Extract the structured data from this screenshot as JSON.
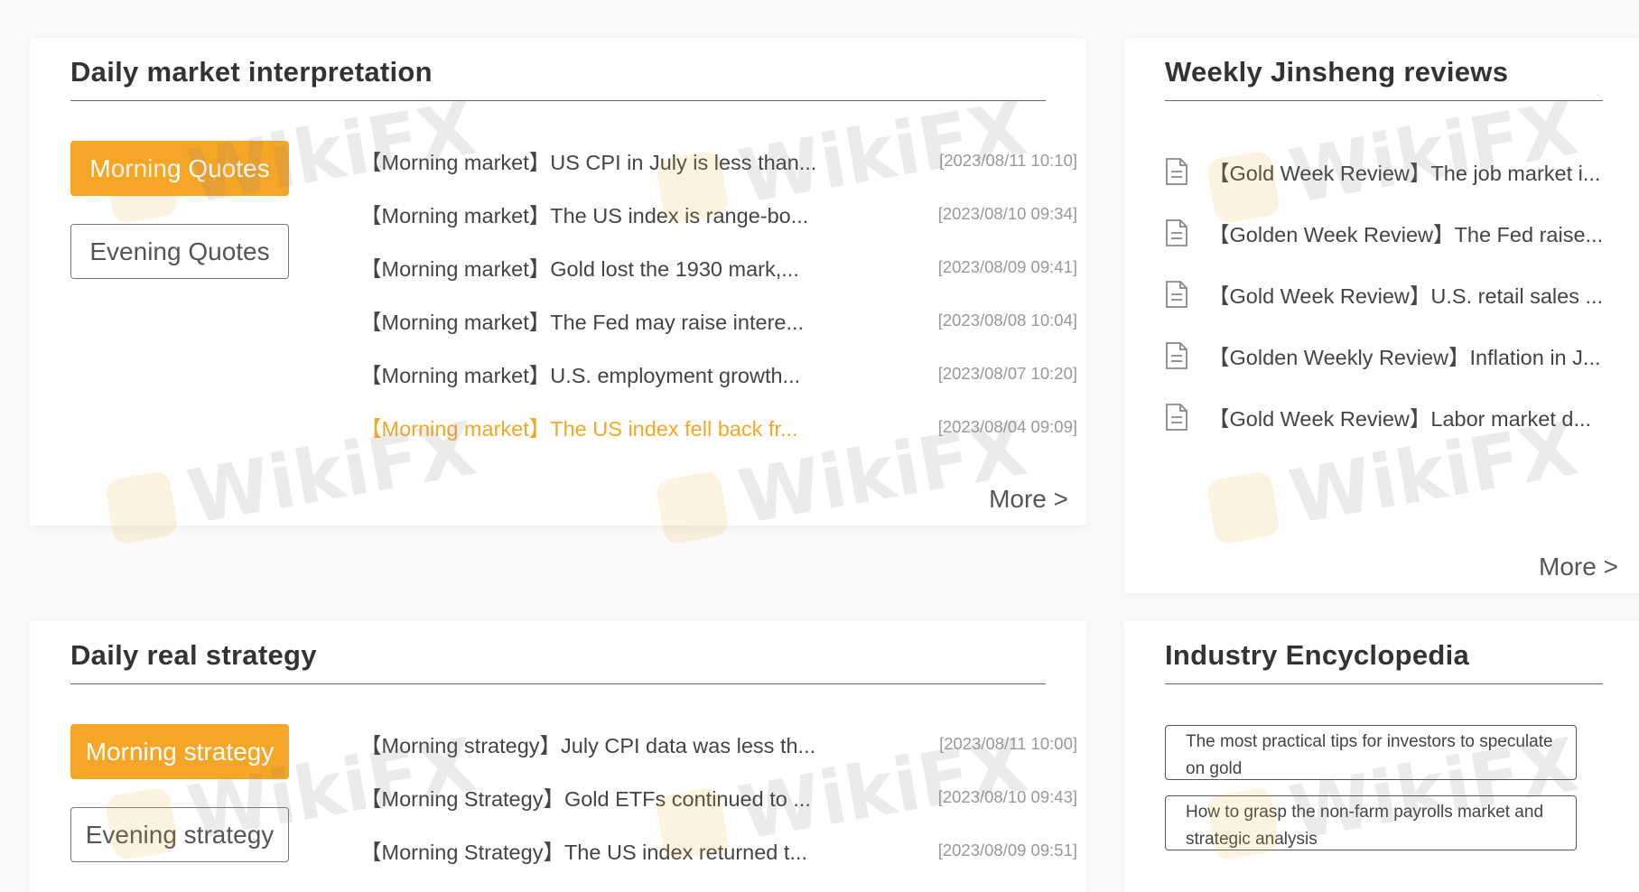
{
  "daily_interpretation": {
    "title": "Daily market interpretation",
    "tabs": [
      {
        "label": "Morning Quotes",
        "active": true
      },
      {
        "label": "Evening Quotes",
        "active": false
      }
    ],
    "items": [
      {
        "title": "【Morning market】US CPI in July is less than...",
        "date": "[2023/08/11 10:10]"
      },
      {
        "title": "【Morning market】The US index is range-bo...",
        "date": "[2023/08/10 09:34]"
      },
      {
        "title": "【Morning market】Gold lost the 1930 mark,...",
        "date": "[2023/08/09 09:41]"
      },
      {
        "title": "【Morning market】The Fed may raise intere...",
        "date": "[2023/08/08 10:04]"
      },
      {
        "title": "【Morning market】U.S. employment growth...",
        "date": "[2023/08/07 10:20]"
      },
      {
        "title": "【Morning market】The US index fell back fr...",
        "date": "[2023/08/04 09:09]"
      }
    ],
    "more_label": "More >"
  },
  "weekly_reviews": {
    "title": "Weekly Jinsheng reviews",
    "items": [
      {
        "title": "【Gold Week Review】The job market i..."
      },
      {
        "title": "【Golden Week Review】The Fed raise..."
      },
      {
        "title": "【Gold Week Review】U.S. retail sales ..."
      },
      {
        "title": "【Golden Weekly Review】Inflation in J..."
      },
      {
        "title": "【Gold Week Review】Labor market d..."
      }
    ],
    "more_label": "More >"
  },
  "daily_strategy": {
    "title": "Daily real strategy",
    "tabs": [
      {
        "label": "Morning strategy",
        "active": true
      },
      {
        "label": "Evening strategy",
        "active": false
      }
    ],
    "items": [
      {
        "title": "【Morning strategy】July CPI data was less th...",
        "date": "[2023/08/11 10:00]"
      },
      {
        "title": "【Morning Strategy】Gold ETFs continued to ...",
        "date": "[2023/08/10 09:43]"
      },
      {
        "title": "【Morning Strategy】The US index returned t...",
        "date": "[2023/08/09 09:51]"
      }
    ]
  },
  "encyclopedia": {
    "title": "Industry Encyclopedia",
    "items": [
      {
        "title": "The most practical tips for investors to speculate on gold"
      },
      {
        "title": "How to grasp the non-farm payrolls market and strategic analysis"
      }
    ]
  },
  "watermark_text": "WikiFX",
  "colors": {
    "accent": "#f6a626",
    "highlight_text": "#f6a626"
  },
  "icons": {
    "review_item": "document-icon"
  }
}
